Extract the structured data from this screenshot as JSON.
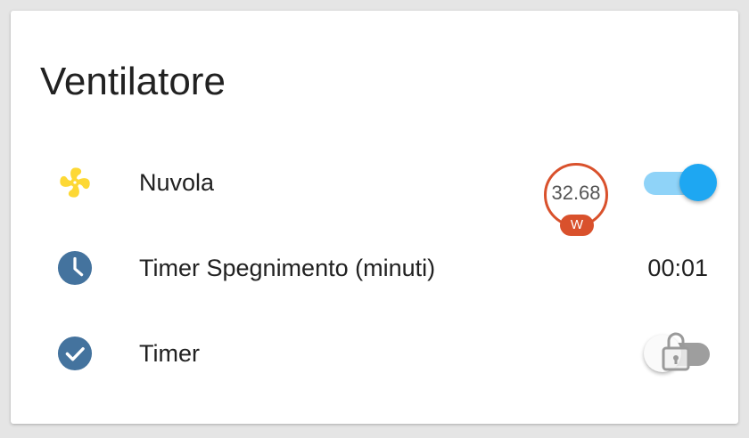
{
  "card": {
    "title": "Ventilatore"
  },
  "rows": [
    {
      "label": "Nuvola",
      "icon": "fan-icon",
      "icon_color": "#fdd835",
      "power_value": "32.68",
      "power_unit": "W",
      "state": "on"
    },
    {
      "label": "Timer Spegnimento (minuti)",
      "icon": "clock-icon",
      "icon_color": "#44739e",
      "value": "00:01"
    },
    {
      "label": "Timer",
      "icon": "check-circle-icon",
      "icon_color": "#44739e",
      "state": "off",
      "locked": true
    }
  ],
  "colors": {
    "toggle_on_thumb": "#1ea7f2",
    "toggle_on_track": "#8fd3f8",
    "badge": "#d9512c"
  }
}
